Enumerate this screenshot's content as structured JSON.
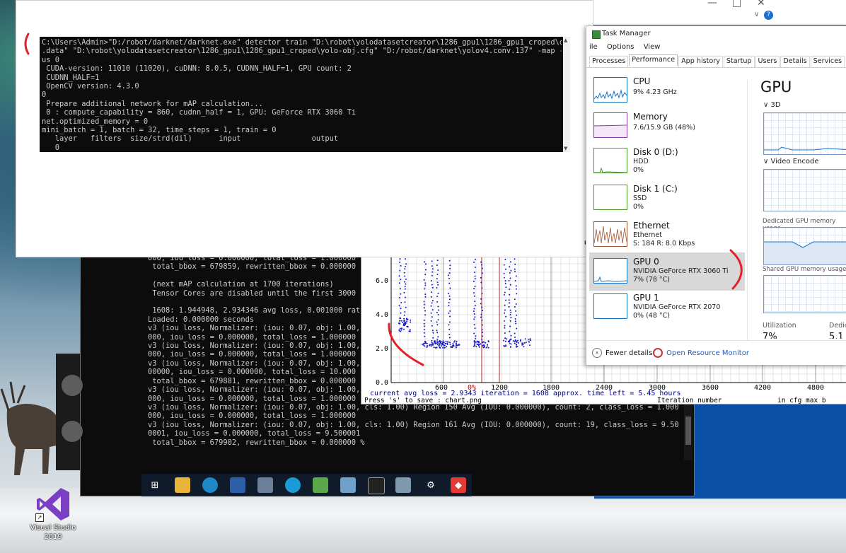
{
  "cmd_main": {
    "lines": [
      "C:\\Users\\Admin>\"D:/robot/darknet/darknet.exe\" detector train \"D:\\robot\\yolodatasetcreator\\1286_gpu1\\1286_gpu1_croped\\obj",
      ".data\" \"D:\\robot\\yolodatasetcreator\\1286_gpu1\\1286_gpu1_croped\\yolo-obj.cfg\" \"D:/robot/darknet\\yolov4.conv.137\" -map -gp",
      "us 0",
      " CUDA-version: 11010 (11020), cuDNN: 8.0.5, CUDNN_HALF=1, GPU count: 2",
      " CUDNN_HALF=1",
      " OpenCV version: 4.3.0",
      "0",
      " Prepare additional network for mAP calculation...",
      " 0 : compute_capability = 860, cudnn_half = 1, GPU: GeForce RTX 3060 Ti",
      "net.optimized_memory = 0",
      "mini_batch = 1, batch = 32, time_steps = 1, train = 0",
      "   layer   filters  size/strd(dil)      input                output",
      "   0 _"
    ]
  },
  "cmd_back": {
    "lines": [
      "000, iou_loss = 0.000000, total_loss = 1.000000",
      " total_bbox = 679859, rewritten_bbox = 0.000000",
      "",
      " (next mAP calculation at 1700 iterations)",
      " Tensor Cores are disabled until the first 3000",
      "",
      " 1608: 1.944948, 2.934346 avg loss, 0.001000 rat",
      "Loaded: 0.000000 seconds",
      "v3 (iou loss, Normalizer: (iou: 0.07, obj: 1.00,",
      "000, iou_loss = 0.000000, total_loss = 1.000000",
      "v3 (iou loss, Normalizer: (iou: 0.07, obj: 1.00,",
      "000, iou_loss = 0.000000, total_loss = 1.000000",
      "v3 (iou loss, Normalizer: (iou: 0.07, obj: 1.00,",
      "00000, iou_loss = 0.000000, total_loss = 10.000",
      " total_bbox = 679881, rewritten_bbox = 0.000000",
      "v3 (iou loss, Normalizer: (iou: 0.07, obj: 1.00,",
      "000, iou_loss = 0.000000, total_loss = 1.000000",
      "v3 (iou loss, Normalizer: (iou: 0.07, obj: 1.00, cls: 1.00) Region 150 Avg (IOU: 0.000000), count: 2, class_loss = 1.000",
      "000, iou_loss = 0.000000, total_loss = 1.000000",
      "v3 (iou loss, Normalizer: (iou: 0.07, obj: 1.00, cls: 1.00) Region 161 Avg (IOU: 0.000000), count: 19, class_loss = 9.50",
      "0001, iou_loss = 0.000000, total_loss = 9.500001",
      " total_bbox = 679902, rewritten_bbox = 0.000000 %"
    ]
  },
  "chart_data": {
    "type": "scatter",
    "x_ticks": [
      "600",
      "0%",
      "1200",
      "1800",
      "2400",
      "3000",
      "3600",
      "4200",
      "4800"
    ],
    "y_ticks": [
      "0.0",
      "2.0",
      "4.0",
      "6.0"
    ],
    "status_line1": "current avg loss = 2.9343    iteration = 1608    approx. time left = 5.45 hours",
    "status_line2": "Press 's' to save : chart.png",
    "status_line2b": "Iteration number",
    "status_line2c": "in cfg max_b",
    "colors": {
      "points": "#1515c8",
      "grid": "#c8c8c8",
      "red_line": "#b02020",
      "axis_text": "#000080"
    }
  },
  "task_manager": {
    "title": "Task Manager",
    "menu": [
      "ile",
      "Options",
      "View"
    ],
    "tabs": [
      "Processes",
      "Performance",
      "App history",
      "Startup",
      "Users",
      "Details",
      "Services"
    ],
    "active_tab": "Performance",
    "resources": [
      {
        "name": "CPU",
        "sub1": "9% 4.23 GHz",
        "sub2": "",
        "sub3": ""
      },
      {
        "name": "Memory",
        "sub1": "7.6/15.9 GB (48%)",
        "sub2": "",
        "sub3": ""
      },
      {
        "name": "Disk 0 (D:)",
        "sub1": "HDD",
        "sub2": "0%",
        "sub3": ""
      },
      {
        "name": "Disk 1 (C:)",
        "sub1": "SSD",
        "sub2": "0%",
        "sub3": ""
      },
      {
        "name": "Ethernet",
        "sub1": "Ethernet",
        "sub2": "S: 184 R: 8.0 Kbps",
        "sub3": ""
      },
      {
        "name": "GPU 0",
        "sub1": "NVIDIA GeForce RTX 3060 Ti",
        "sub2": "7% (78 °C)",
        "sub3": ""
      },
      {
        "name": "GPU 1",
        "sub1": "NVIDIA GeForce RTX 2070",
        "sub2": "0% (48 °C)",
        "sub3": ""
      }
    ],
    "gpu_title": "GPU",
    "sections": [
      "3D",
      "Video Encode"
    ],
    "labels": {
      "dedicated": "Dedicated GPU memory usage",
      "shared": "Shared GPU memory usage",
      "utilization": "Utilization",
      "dedic": "Dedic",
      "util_value": "7%",
      "dedic_value": "5.1"
    },
    "fewer_details": "Fewer details",
    "open_resource_monitor": "Open Resource Monitor"
  },
  "desktop": {
    "vs_label": "Visual Studio 2019"
  },
  "taskbar": {
    "icons": [
      "start-icon",
      "file-explorer-icon",
      "edge-icon",
      "visual-studio-code-icon",
      "photos-icon",
      "browser-icon",
      "notepad-icon",
      "tablet-icon",
      "terminal-icon",
      "app-icon",
      "settings-icon",
      "anydesk-icon"
    ]
  }
}
